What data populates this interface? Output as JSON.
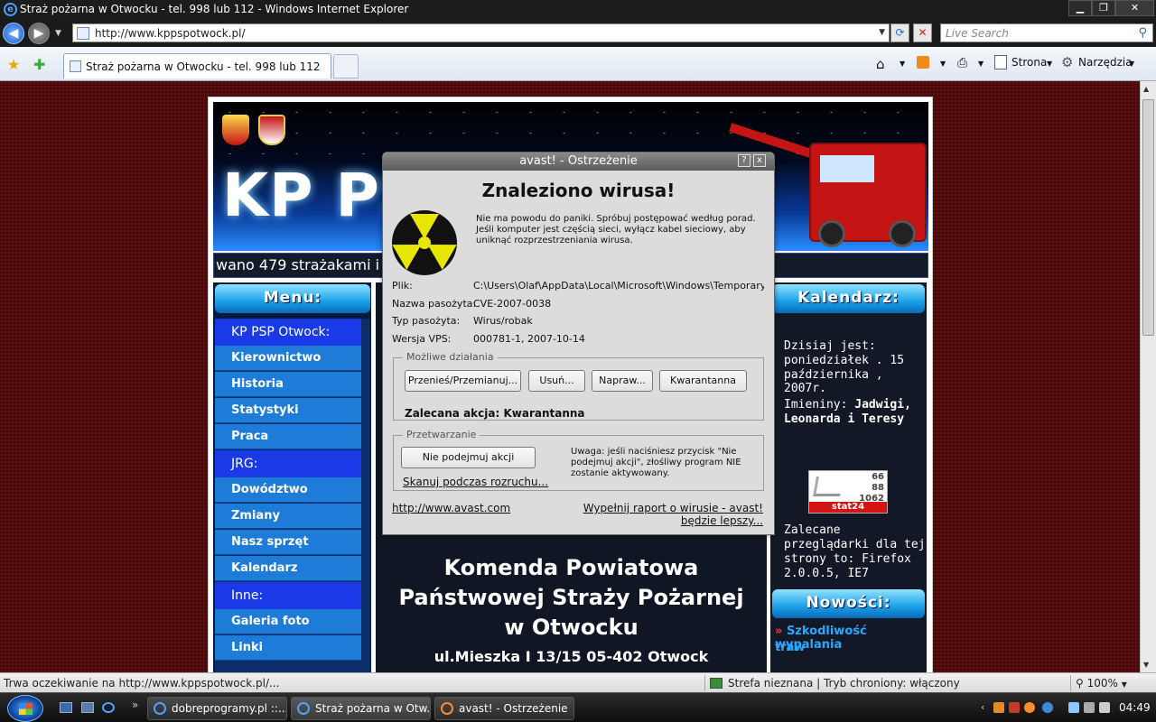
{
  "window": {
    "title": "Straż pożarna w Otwocku - tel. 998 lub 112 - Windows Internet Explorer",
    "min_label": "▁",
    "max_label": "❐",
    "close_label": "✕"
  },
  "address": {
    "url": "http://www.kppspotwock.pl/",
    "search_placeholder": "Live Search"
  },
  "tab": {
    "label": "Straż pożarna w Otwocku - tel. 998 lub 112"
  },
  "commands": {
    "page": "Strona",
    "tools": "Narzędzia"
  },
  "site": {
    "banner_text": "KP PSP",
    "marquee": "wano 479 strażakami i 72 w",
    "menu_header": "Menu:",
    "menu": [
      {
        "label": "KP PSP Otwock:",
        "type": "section"
      },
      {
        "label": "Kierownictwo",
        "type": "item"
      },
      {
        "label": "Historia",
        "type": "item"
      },
      {
        "label": "Statystyki",
        "type": "item"
      },
      {
        "label": "Praca",
        "type": "item"
      },
      {
        "label": "JRG:",
        "type": "section"
      },
      {
        "label": "Dowództwo",
        "type": "item"
      },
      {
        "label": "Zmiany",
        "type": "item"
      },
      {
        "label": "Nasz sprzęt",
        "type": "item"
      },
      {
        "label": "Kalendarz zmianowy",
        "type": "item"
      },
      {
        "label": "Inne:",
        "type": "section"
      },
      {
        "label": "Galeria foto",
        "type": "item"
      },
      {
        "label": "Linki",
        "type": "item"
      }
    ],
    "calendar_header": "Kalendarz:",
    "today_line1": "Dzisiaj jest:",
    "today_line2": "poniedziałek . 15",
    "today_line3": "października , 2007r.",
    "names_label": "Imieniny:",
    "names_line1": "Jadwigi,",
    "names_line2": "Leonarda i Teresy",
    "stat": {
      "n1": "66",
      "n2": "88",
      "n3": "1062",
      "label": "stat24"
    },
    "browsers_line1": "Zalecane",
    "browsers_line2": "przeglądarki dla tej",
    "browsers_line3": "strony to: Firefox",
    "browsers_line4": "2.0.0.5, IE7",
    "news_header": "Nowości:",
    "news_item_line1": "Szkodliwość wypalania",
    "news_item_line2": "traw",
    "kom_line1": "Komenda Powiatowa",
    "kom_line2": "Państwowej Straży Pożarnej",
    "kom_line3": "w Otwocku",
    "address_line": "ul.Mieszka I 13/15 05-402 Otwock"
  },
  "dialog": {
    "title": "avast! - Ostrzeżenie",
    "help_label": "?",
    "close_label": "x",
    "headline": "Znaleziono wirusa!",
    "message": "Nie ma powodu do paniki. Spróbuj postępować według porad. Jeśli komputer jest częścią sieci, wyłącz kabel sieciowy, aby uniknąć rozprzestrzeniania wirusa.",
    "file_label": "Plik:",
    "file_value": "C:\\Users\\Olaf\\AppData\\Local\\Microsoft\\Windows\\Temporary Inter",
    "name_label": "Nazwa pasożyta:",
    "name_value": "CVE-2007-0038",
    "type_label": "Typ pasożyta:",
    "type_value": "Wirus/robak",
    "vps_label": "Wersja VPS:",
    "vps_value": "000781-1, 2007-10-14",
    "actions_caption": "Możliwe działania",
    "btn_move": "Przenieś/Przemianuj...",
    "btn_delete": "Usuń...",
    "btn_repair": "Napraw...",
    "btn_quarantine": "Kwarantanna",
    "recommended": "Zalecana akcja: Kwarantanna",
    "processing_caption": "Przetwarzanie",
    "btn_noaction": "Nie podejmuj akcji",
    "scan_link": "Skanuj podczas rozruchu...",
    "note": "Uwaga: jeśli naciśniesz przycisk \"Nie podejmuj akcji\", złośliwy program NIE zostanie aktywowany.",
    "link_avast": "http://www.avast.com",
    "link_report": "Wypełnij raport o wirusie - avast! będzie lepszy..."
  },
  "status": {
    "text": "Trwa oczekiwanie na http://www.kppspotwock.pl/...",
    "zone": "Strefa nieznana | Tryb chroniony: włączony",
    "zoom": "100%"
  },
  "taskbar": {
    "items": [
      "dobreprogramy.pl ::...",
      "Straż pożarna w Otw...",
      "avast! - Ostrzeżenie"
    ],
    "clock": "04:49"
  }
}
